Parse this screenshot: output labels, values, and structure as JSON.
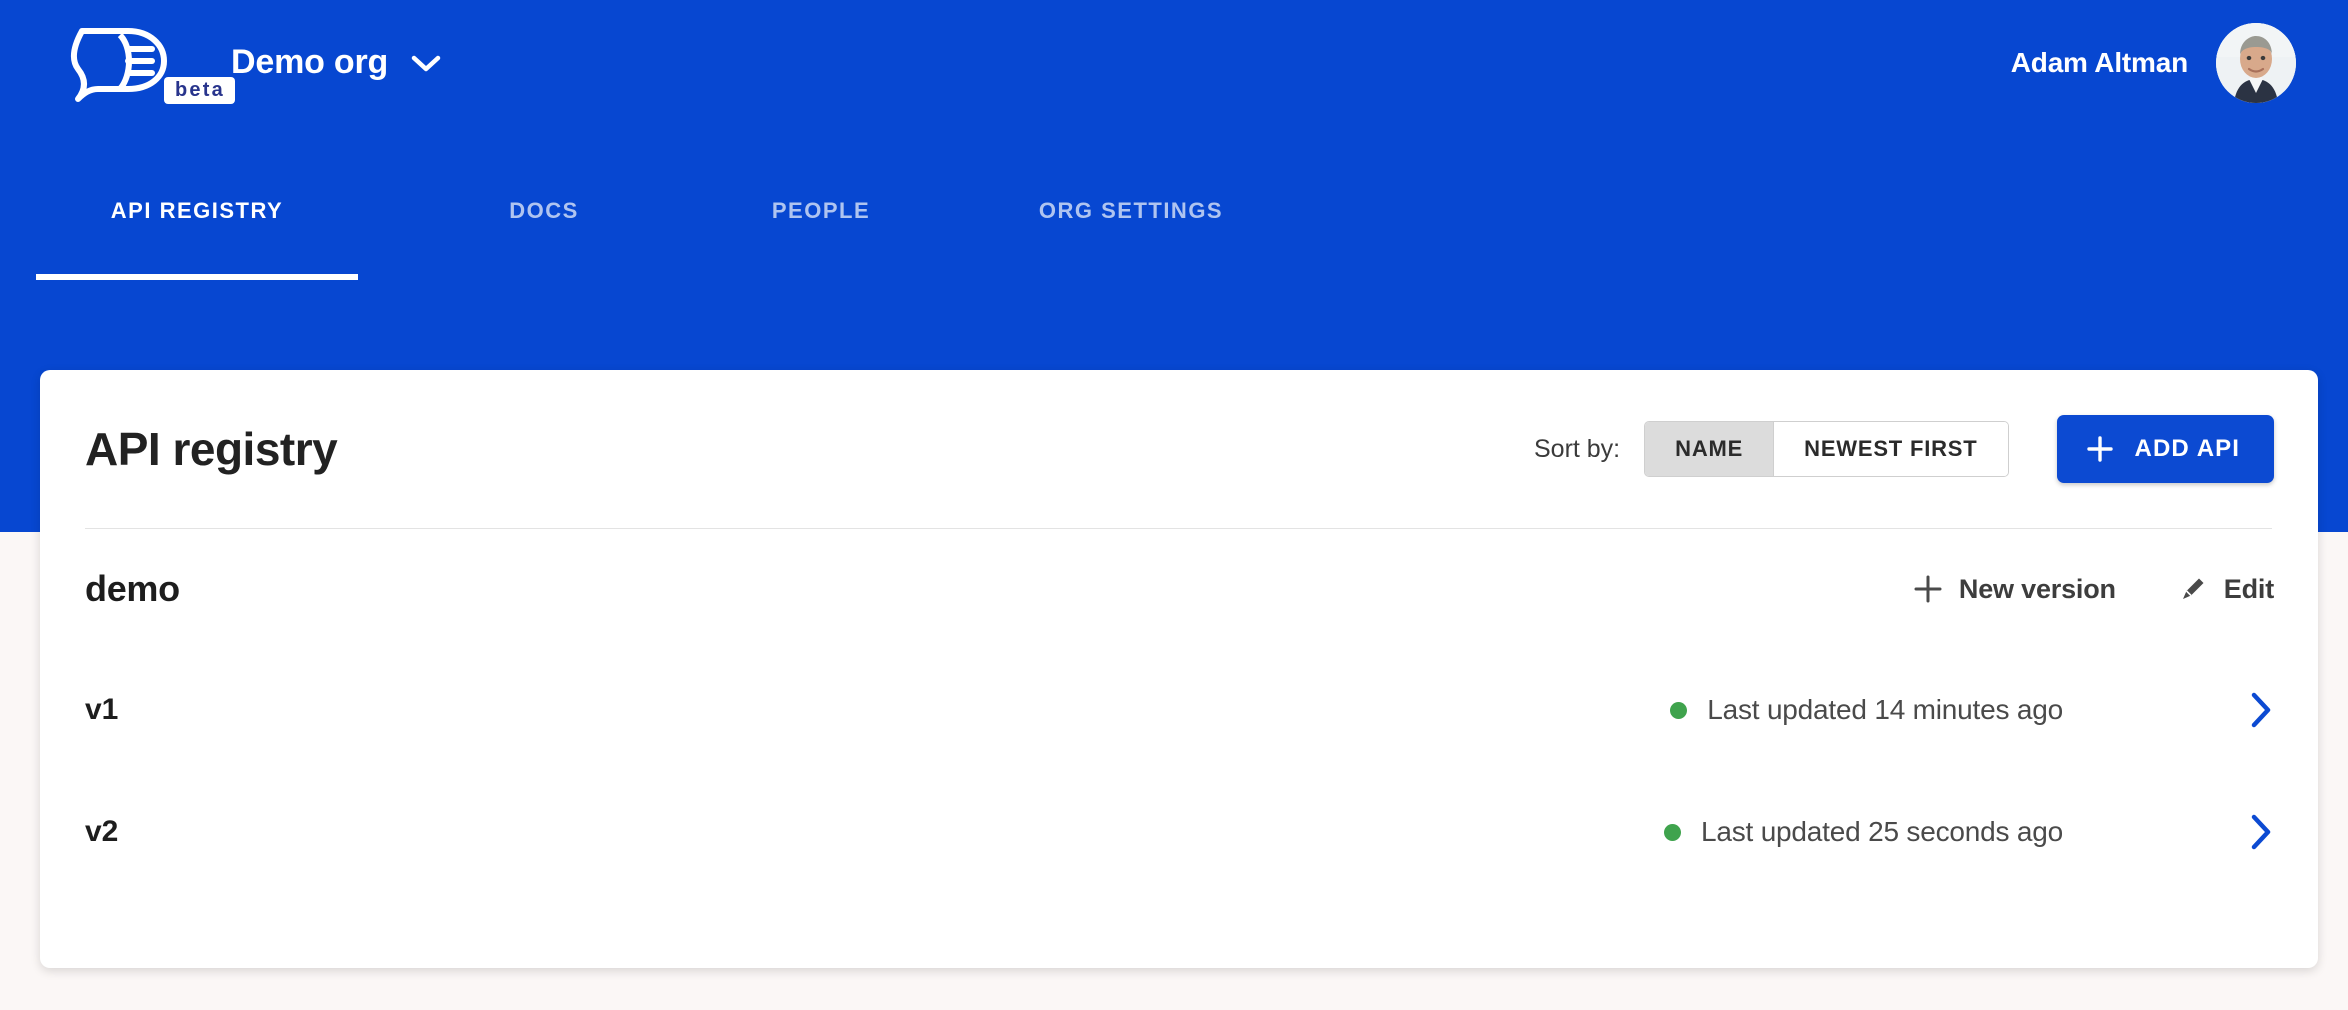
{
  "colors": {
    "header_blue": "#0747d1",
    "button_blue": "#0c4ad2",
    "page_background": "#fbf7f6",
    "card_background": "#ffffff",
    "status_green": "#3fa34d",
    "chevron_blue": "#0c4ad2",
    "beta_badge_text": "#28348c"
  },
  "header": {
    "logo_icon": "document-speech-logo-icon",
    "beta_badge": "beta",
    "org_name": "Demo org",
    "org_caret_icon": "chevron-down-icon",
    "user_name": "Adam Altman",
    "avatar_icon": "avatar"
  },
  "tabs": [
    {
      "label": "API REGISTRY",
      "active": true
    },
    {
      "label": "DOCS",
      "active": false
    },
    {
      "label": "PEOPLE",
      "active": false
    },
    {
      "label": "ORG SETTINGS",
      "active": false
    }
  ],
  "card": {
    "title": "API registry",
    "sort": {
      "label": "Sort by:",
      "options": [
        {
          "label": "NAME",
          "selected": true
        },
        {
          "label": "NEWEST FIRST",
          "selected": false
        }
      ]
    },
    "add_api": {
      "label": "ADD API",
      "icon": "plus-icon"
    }
  },
  "api_groups": [
    {
      "name": "demo",
      "actions": [
        {
          "label": "New version",
          "icon": "plus-icon"
        },
        {
          "label": "Edit",
          "icon": "pencil-icon"
        }
      ],
      "versions": [
        {
          "label": "v1",
          "status": "active",
          "updated": "Last updated 14 minutes ago",
          "chevron": "chevron-right-icon"
        },
        {
          "label": "v2",
          "status": "active",
          "updated": "Last updated 25 seconds ago",
          "chevron": "chevron-right-icon"
        }
      ]
    }
  ]
}
